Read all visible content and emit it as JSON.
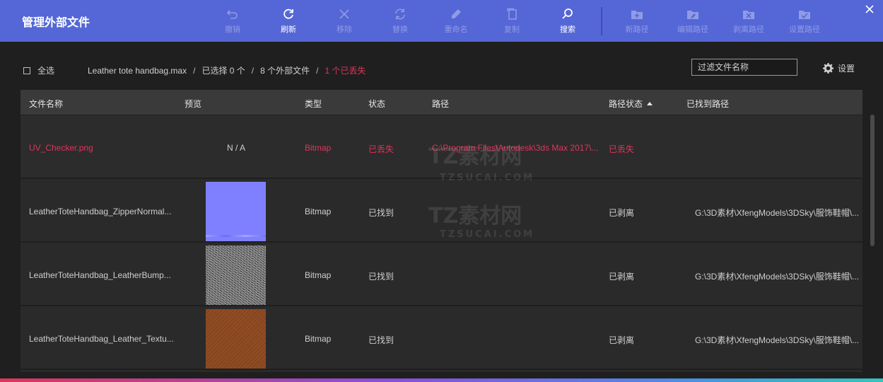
{
  "window": {
    "title": "管理外部文件"
  },
  "toolbar": {
    "tools": [
      {
        "label": "撤销",
        "icon": "undo-icon",
        "active": false
      },
      {
        "label": "刷新",
        "icon": "refresh-icon",
        "active": true
      },
      {
        "label": "移除",
        "icon": "remove-icon",
        "active": false
      },
      {
        "label": "替换",
        "icon": "replace-icon",
        "active": false
      },
      {
        "label": "重命名",
        "icon": "rename-icon",
        "active": false
      },
      {
        "label": "复制",
        "icon": "copy-icon",
        "active": false
      },
      {
        "label": "搜索",
        "icon": "search-icon",
        "active": true
      },
      {
        "label": "新路径",
        "icon": "new-path-icon",
        "active": false
      },
      {
        "label": "编辑路径",
        "icon": "edit-path-icon",
        "active": false
      },
      {
        "label": "剥离路径",
        "icon": "strip-path-icon",
        "active": false
      },
      {
        "label": "设置路径",
        "icon": "set-path-icon",
        "active": false
      }
    ]
  },
  "info": {
    "select_all": "全选",
    "scene_file": "Leather tote handbag.max",
    "selected_count": "已选择 0 个",
    "external_count": "8 个外部文件",
    "missing_count": "1 个已丢失",
    "filter_placeholder": "过滤文件名称",
    "settings_label": "设置"
  },
  "table": {
    "columns": [
      "文件名称",
      "预览",
      "类型",
      "状态",
      "路径",
      "路径状态",
      "已找到路径"
    ],
    "rows": [
      {
        "name": "UV_Checker.png",
        "preview": "N / A",
        "type": "Bitmap",
        "status": "已丢失",
        "path": "C:\\Program Files\\Autodesk\\3ds Max 2017\\...",
        "path_status": "已丢失",
        "found_path": ""
      },
      {
        "name": "LeatherToteHandbag_ZipperNormal...",
        "preview": "",
        "type": "Bitmap",
        "status": "已找到",
        "path": "",
        "path_status": "已剥离",
        "found_path": "G:\\3D素材\\XfengModels\\3DSky\\服饰鞋帽\\..."
      },
      {
        "name": "LeatherToteHandbag_LeatherBump...",
        "preview": "",
        "type": "Bitmap",
        "status": "已找到",
        "path": "",
        "path_status": "已剥离",
        "found_path": "G:\\3D素材\\XfengModels\\3DSky\\服饰鞋帽\\..."
      },
      {
        "name": "LeatherToteHandbag_Leather_Textu...",
        "preview": "",
        "type": "Bitmap",
        "status": "已找到",
        "path": "",
        "path_status": "已剥离",
        "found_path": "G:\\3D素材\\XfengModels\\3DSky\\服饰鞋帽\\..."
      }
    ]
  },
  "watermark": {
    "brand": "TZ素材网",
    "domain": "TZSUCAI.COM"
  },
  "colors": {
    "header": "#5567d6",
    "missing": "#e0345a",
    "background": "#1f1f1f"
  }
}
